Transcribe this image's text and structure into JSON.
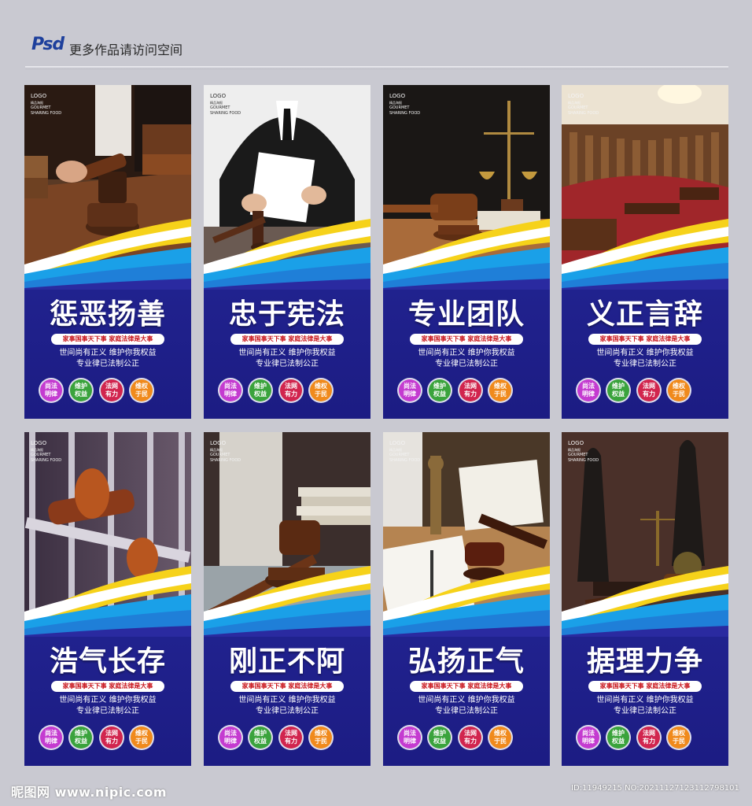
{
  "header": {
    "psd_label": "Psd",
    "text": "更多作品请访问空间"
  },
  "logo": {
    "line1": "LOGO",
    "line2": "精品海报",
    "line3": "GOURMET",
    "line4": "SHARING FOOD"
  },
  "cards": [
    {
      "title": "惩恶扬善",
      "photo": "judge-gavel-hand"
    },
    {
      "title": "忠于宪法",
      "photo": "judge-in-robe-reading"
    },
    {
      "title": "专业团队",
      "photo": "scales-and-gavel"
    },
    {
      "title": "义正言辞",
      "photo": "courtroom-interior"
    },
    {
      "title": "浩气长存",
      "photo": "hands-on-prison-bars"
    },
    {
      "title": "刚正不阿",
      "photo": "gavel-on-glass-books"
    },
    {
      "title": "弘扬正气",
      "photo": "justice-statue-open-book"
    },
    {
      "title": "据理力争",
      "photo": "lady-justice-statues"
    }
  ],
  "card_common": {
    "slogan": "家事国事天下事 家庭法律是大事",
    "desc_line1": "世间尚有正义 维护你我权益",
    "desc_line2": "专业律已法制公正",
    "badges": [
      {
        "text": "尚法明律",
        "color": "#c43bd0"
      },
      {
        "text": "维护权益",
        "color": "#3aa33c"
      },
      {
        "text": "法网有力",
        "color": "#d1254e"
      },
      {
        "text": "维权于民",
        "color": "#f08a1c"
      }
    ]
  },
  "footer": {
    "site": "昵图网 www.nipic.com",
    "id": "ID:11949215 NO:20211127123112798101"
  },
  "colors": {
    "card_blue": "#232594",
    "wave_light_blue": "#1aa0e8",
    "wave_yellow": "#f6d21a",
    "slogan_red": "#c8151c"
  }
}
